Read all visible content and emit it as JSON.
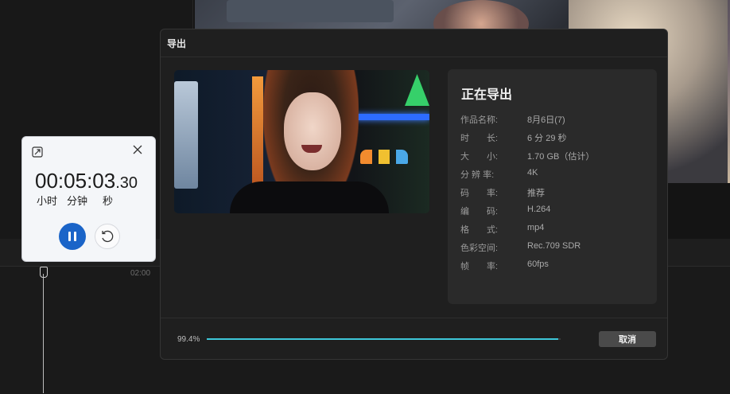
{
  "background": {
    "timeline_tick": "02:00"
  },
  "dialog": {
    "title": "导出",
    "info": {
      "heading": "正在导出",
      "rows": [
        {
          "key": "作品名称:",
          "value": "8月6日(7)"
        },
        {
          "key": "时　　长:",
          "value": "6 分 29 秒"
        },
        {
          "key": "大　　小:",
          "value": "1.70 GB（估计）"
        },
        {
          "key": "分 辨 率:",
          "value": "4K"
        },
        {
          "key": "码　　率:",
          "value": "推荐"
        },
        {
          "key": "编　　码:",
          "value": "H.264"
        },
        {
          "key": "格　　式:",
          "value": "mp4"
        },
        {
          "key": "色彩空间:",
          "value": "Rec.709 SDR"
        },
        {
          "key": "帧　　率:",
          "value": "60fps"
        }
      ]
    },
    "progress": {
      "label": "99.4%",
      "fraction": 0.994,
      "color": "#3ec7d8"
    },
    "cancel_label": "取消"
  },
  "stopwatch": {
    "time_main": "00:05:03",
    "time_fraction": ".30",
    "units": [
      "小时",
      "分钟",
      "秒"
    ],
    "icons": [
      "expand-icon",
      "close-icon",
      "pause-icon",
      "reset-icon"
    ],
    "accent_color": "#1a64c8"
  }
}
